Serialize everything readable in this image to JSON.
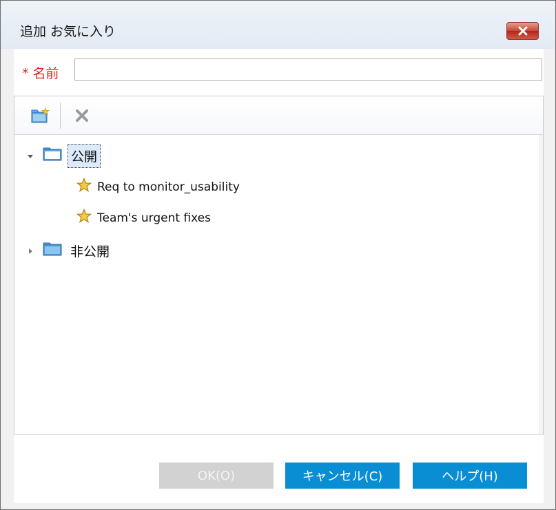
{
  "window": {
    "title": "追加 お気に入り",
    "close_icon": "close-icon"
  },
  "name_field": {
    "label": "* 名前",
    "value": ""
  },
  "toolbar": {
    "new_folder_icon": "new-folder-icon",
    "delete_icon": "delete-icon"
  },
  "tree": {
    "public_folder": {
      "label": "公開",
      "expanded": true,
      "selected": true,
      "items": [
        {
          "label": "Req to monitor_usability",
          "icon": "star-icon"
        },
        {
          "label": "Team's urgent fixes",
          "icon": "star-icon"
        }
      ]
    },
    "private_folder": {
      "label": "非公開",
      "expanded": false
    }
  },
  "buttons": {
    "ok": "OK(O)",
    "cancel": "キャンセル(C)",
    "help": "ヘルプ(H)"
  },
  "colors": {
    "required_label": "#e02020",
    "primary_button": "#0a8ed3",
    "disabled_button": "#d2d2d2",
    "selection": "#dcebfb"
  }
}
